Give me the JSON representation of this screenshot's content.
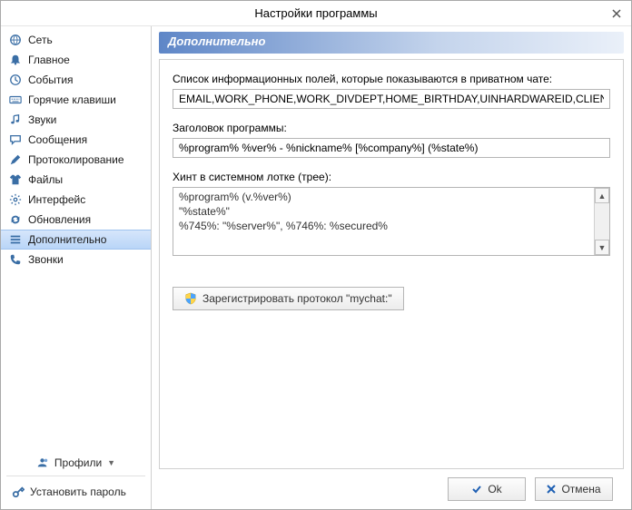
{
  "window": {
    "title": "Настройки программы"
  },
  "sidebar": {
    "items": [
      {
        "id": "network",
        "icon": "globe",
        "label": "Сеть"
      },
      {
        "id": "main",
        "icon": "bell",
        "label": "Главное"
      },
      {
        "id": "events",
        "icon": "clock",
        "label": "События"
      },
      {
        "id": "hotkeys",
        "icon": "keyboard",
        "label": "Горячие клавиши"
      },
      {
        "id": "sounds",
        "icon": "note",
        "label": "Звуки"
      },
      {
        "id": "messages",
        "icon": "bubble",
        "label": "Сообщения"
      },
      {
        "id": "logging",
        "icon": "pencil",
        "label": "Протоколирование"
      },
      {
        "id": "files",
        "icon": "shirt",
        "label": "Файлы"
      },
      {
        "id": "interface",
        "icon": "gear",
        "label": "Интерфейс"
      },
      {
        "id": "updates",
        "icon": "refresh",
        "label": "Обновления"
      },
      {
        "id": "advanced",
        "icon": "bars",
        "label": "Дополнительно",
        "selected": true
      },
      {
        "id": "calls",
        "icon": "phone",
        "label": "Звонки"
      }
    ],
    "profiles_label": "Профили",
    "set_password_label": "Установить пароль"
  },
  "main": {
    "section_title": "Дополнительно",
    "info_fields_label": "Список информационных полей, которые показываются в приватном чате:",
    "info_fields_value": "EMAIL,WORK_PHONE,WORK_DIVDEPT,HOME_BIRTHDAY,UINHARDWAREID,CLIENTVERSION,HOME",
    "program_title_label": "Заголовок программы:",
    "program_title_value": "%program% %ver% - %nickname% [%company%] (%state%)",
    "tray_hint_label": "Хинт в системном лотке (трее):",
    "tray_hint_value": "%program% (v.%ver%)\n\"%state%\"\n%745%: \"%server%\", %746%: %secured%",
    "register_button": "Зарегистрировать протокол \"mychat:\""
  },
  "footer": {
    "ok": "Ok",
    "cancel": "Отмена"
  }
}
